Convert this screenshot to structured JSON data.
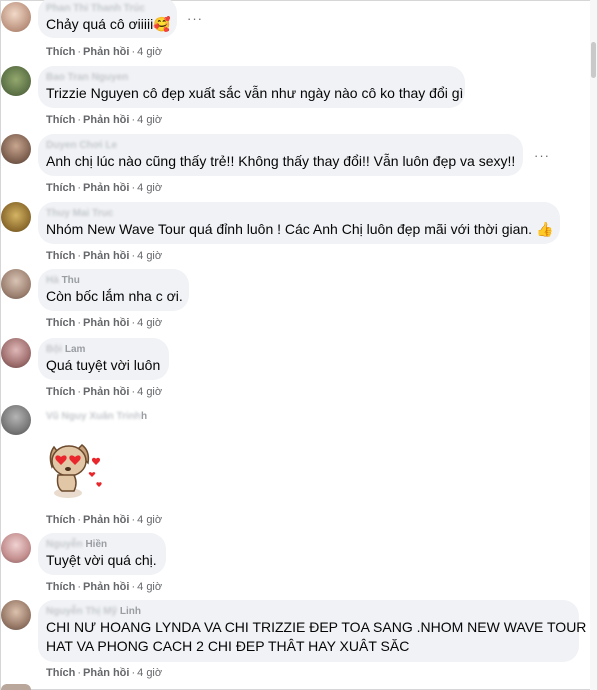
{
  "actions": {
    "like": "Thích",
    "reply": "Phản hồi",
    "sep": "·"
  },
  "more_glyph": "···",
  "comments": [
    {
      "author_blur": "Phan Thi Thanh Trúc",
      "author_clear": "",
      "text": "Chảy quá cô ơiiiii🥰",
      "time": "4 giờ"
    },
    {
      "author_blur": "Bao Tran Nguyen",
      "author_clear": "",
      "text": "Trizzie Nguyen cô đẹp xuất sắc vẫn như ngày nào cô ko thay đổi gì",
      "time": "4 giờ"
    },
    {
      "author_blur": "Duyen Chơi Le",
      "author_clear": "",
      "text": "Anh chị lúc nào cũng thấy trẻ!! Không thấy thay đổi!! Vẫn luôn đẹp va sexy!!",
      "time": "4 giờ"
    },
    {
      "author_blur": "Thuy Mai Truc",
      "author_clear": "",
      "text": "Nhóm New Wave Tour quá đỉnh luôn ! Các Anh Chị luôn đẹp mãi với thời gian. 👍",
      "time": "4 giờ"
    },
    {
      "author_blur": "Hà",
      "author_clear": "Thu",
      "text": "Còn bốc lắm nha c ơi.",
      "time": "4 giờ"
    },
    {
      "author_blur": "Bội",
      "author_clear": "Lam",
      "text": "Quá tuyệt vời luôn",
      "time": "4 giờ"
    },
    {
      "author_blur": "Vũ Nguy Xuân Trinh",
      "author_clear": "h",
      "text": "",
      "time": "4 giờ",
      "sticker": "dog-heart-eyes-sticker"
    },
    {
      "author_blur": "Nguyễn",
      "author_clear": "Hiền",
      "text": "Tuyệt vời quá chị.",
      "time": "4 giờ"
    },
    {
      "author_blur": "Nguyễn Thị Mỹ",
      "author_clear": "Linh",
      "text_lines": [
        "CHI NƯ HOANG LYNDA VA CHI TRIZZIE ĐEP TOA SANG .NHOM NEW WAVE TOUR",
        "HAT VA PHONG CACH 2 CHI ĐEP THÂT HAY XUÂT SĂC"
      ],
      "time": "4 giờ"
    }
  ]
}
